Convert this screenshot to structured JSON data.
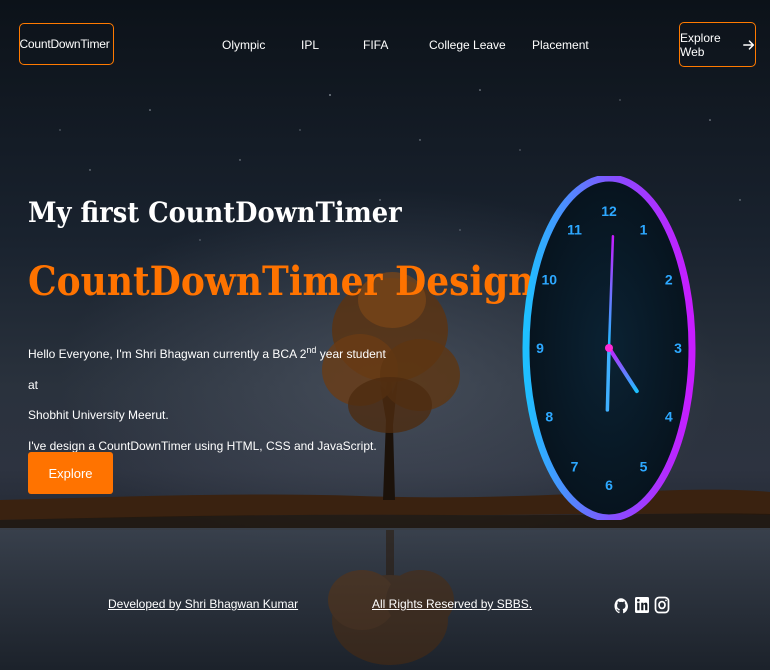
{
  "nav": {
    "brand": "CountDownTimer",
    "links": [
      "Olympic",
      "IPL",
      "FIFA",
      "College Leave",
      "Placement"
    ],
    "cta": "Explore Web"
  },
  "hero": {
    "title": "My first CountDownTimer",
    "subtitle": "CountDownTimer Design",
    "line1_pre": "Hello Everyone, I'm Shri Bhagwan currently a BCA 2",
    "line1_sup": "nd",
    "line1_post": " year student at",
    "line2": "Shobhit University Meerut.",
    "line3": "I've design a CountDownTimer using HTML, CSS and JavaScript.",
    "button": "Explore"
  },
  "clock": {
    "numbers": [
      "12",
      "1",
      "2",
      "3",
      "4",
      "5",
      "6",
      "7",
      "8",
      "9",
      "10",
      "11"
    ],
    "hour_angle_deg": 128,
    "minute_angle_deg": 183,
    "second_angle_deg": 4
  },
  "footer": {
    "developer": "Developed by Shri Bhagwan Kumar",
    "rights": "All Rights Reserved by SBBS.",
    "social": [
      "github-icon",
      "linkedin-icon",
      "instagram-icon"
    ]
  },
  "colors": {
    "accent": "#ff7300",
    "clock_blue": "#2da8ff",
    "clock_purple": "#c021ff"
  }
}
